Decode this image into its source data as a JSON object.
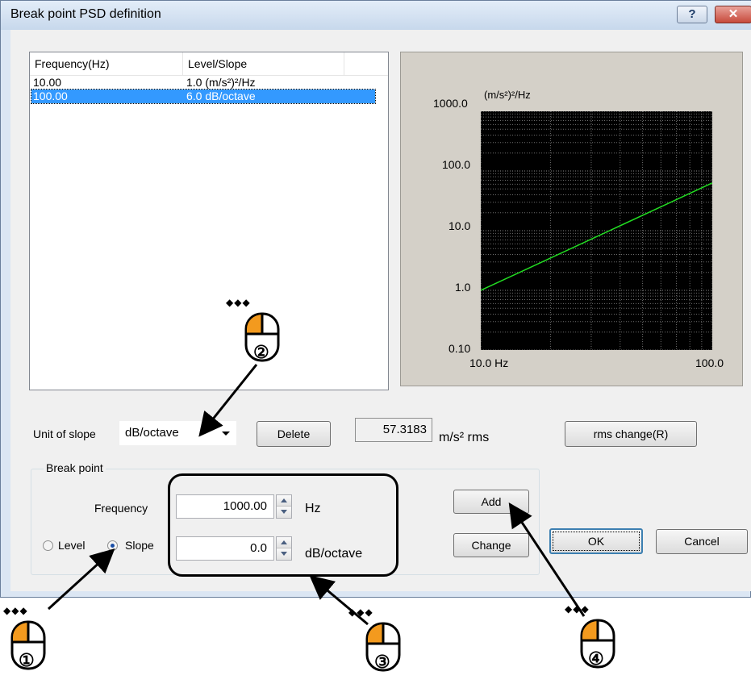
{
  "window": {
    "title": "Break point PSD definition",
    "help_label": "?",
    "close_label": "✕"
  },
  "list": {
    "columns": [
      "Frequency(Hz)",
      "Level/Slope"
    ],
    "rows": [
      {
        "freq": "10.00",
        "value": "1.0 (m/s²)²/Hz",
        "selected": false
      },
      {
        "freq": "100.00",
        "value": "6.0  dB/octave",
        "selected": true
      }
    ]
  },
  "graph": {
    "unit_label": "(m/s²)²/Hz",
    "y_ticks": [
      "1000.0",
      "100.0",
      "10.0",
      "1.0",
      "0.10"
    ],
    "x_ticks": [
      "10.0 Hz",
      "100.0"
    ],
    "colors": {
      "background": "#000000",
      "line": "#22dd22",
      "panel": "#d4d0c8"
    }
  },
  "chart_data": {
    "type": "line",
    "x": [
      10.0,
      100.0
    ],
    "y": [
      1.0,
      63.0
    ],
    "xlim": [
      10.0,
      100.0
    ],
    "ylim": [
      0.1,
      1000.0
    ],
    "log_x": true,
    "log_y": true,
    "ylabel": "(m/s²)²/Hz",
    "xlabel": "Hz",
    "grid": true
  },
  "controls": {
    "unit_of_slope_label": "Unit of slope",
    "unit_of_slope_value": "dB/octave",
    "delete_label": "Delete",
    "rms_value": "57.3183",
    "rms_unit": "m/s² rms",
    "rms_change_label": "rms change(R)"
  },
  "breakpoint": {
    "group_label": "Break point",
    "frequency_label": "Frequency",
    "frequency_value": "1000.00",
    "frequency_unit": "Hz",
    "level_label": "Level",
    "slope_label": "Slope",
    "slope_selected": true,
    "slope_value": "0.0",
    "slope_unit": "dB/octave",
    "add_label": "Add",
    "change_label": "Change"
  },
  "dialog_buttons": {
    "ok_label": "OK",
    "cancel_label": "Cancel"
  },
  "annotations": {
    "steps": [
      "①",
      "②",
      "③",
      "④"
    ],
    "mouse_accent": "#f39a1e"
  }
}
